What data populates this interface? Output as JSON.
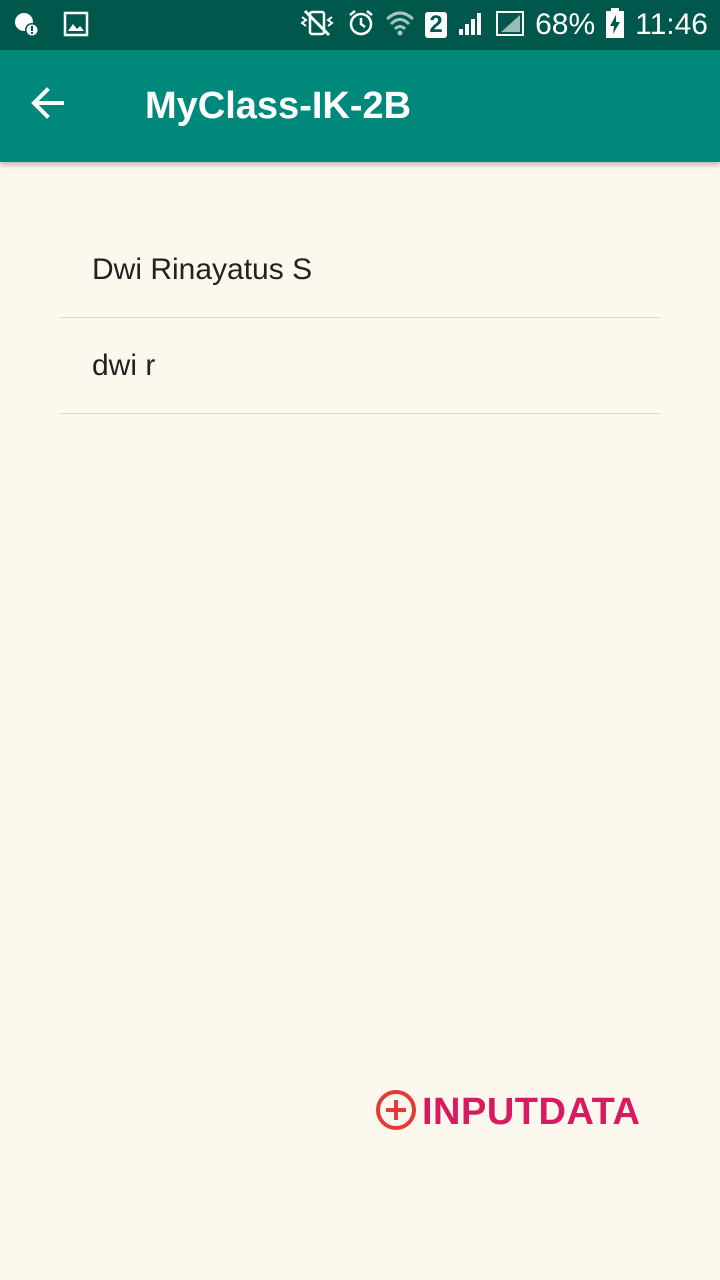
{
  "status_bar": {
    "battery_percent": "68%",
    "time": "11:46",
    "sim_slot": "2",
    "icons": [
      "location-alert-icon",
      "gallery-icon",
      "vibrate-mute-icon",
      "alarm-icon",
      "wifi-icon",
      "sim2-icon",
      "signal-icon",
      "signal-empty-icon",
      "battery-charging-icon"
    ]
  },
  "app_bar": {
    "title": "MyClass-IK-2B",
    "back_icon": "arrow-back-icon",
    "color": "#00897b"
  },
  "list": {
    "items": [
      {
        "label": "Dwi Rinayatus S"
      },
      {
        "label": "dwi r"
      }
    ]
  },
  "action": {
    "label": "INPUTDATA",
    "icon": "add-circle-icon",
    "label_color": "#d81b60",
    "icon_color": "#e53935"
  }
}
